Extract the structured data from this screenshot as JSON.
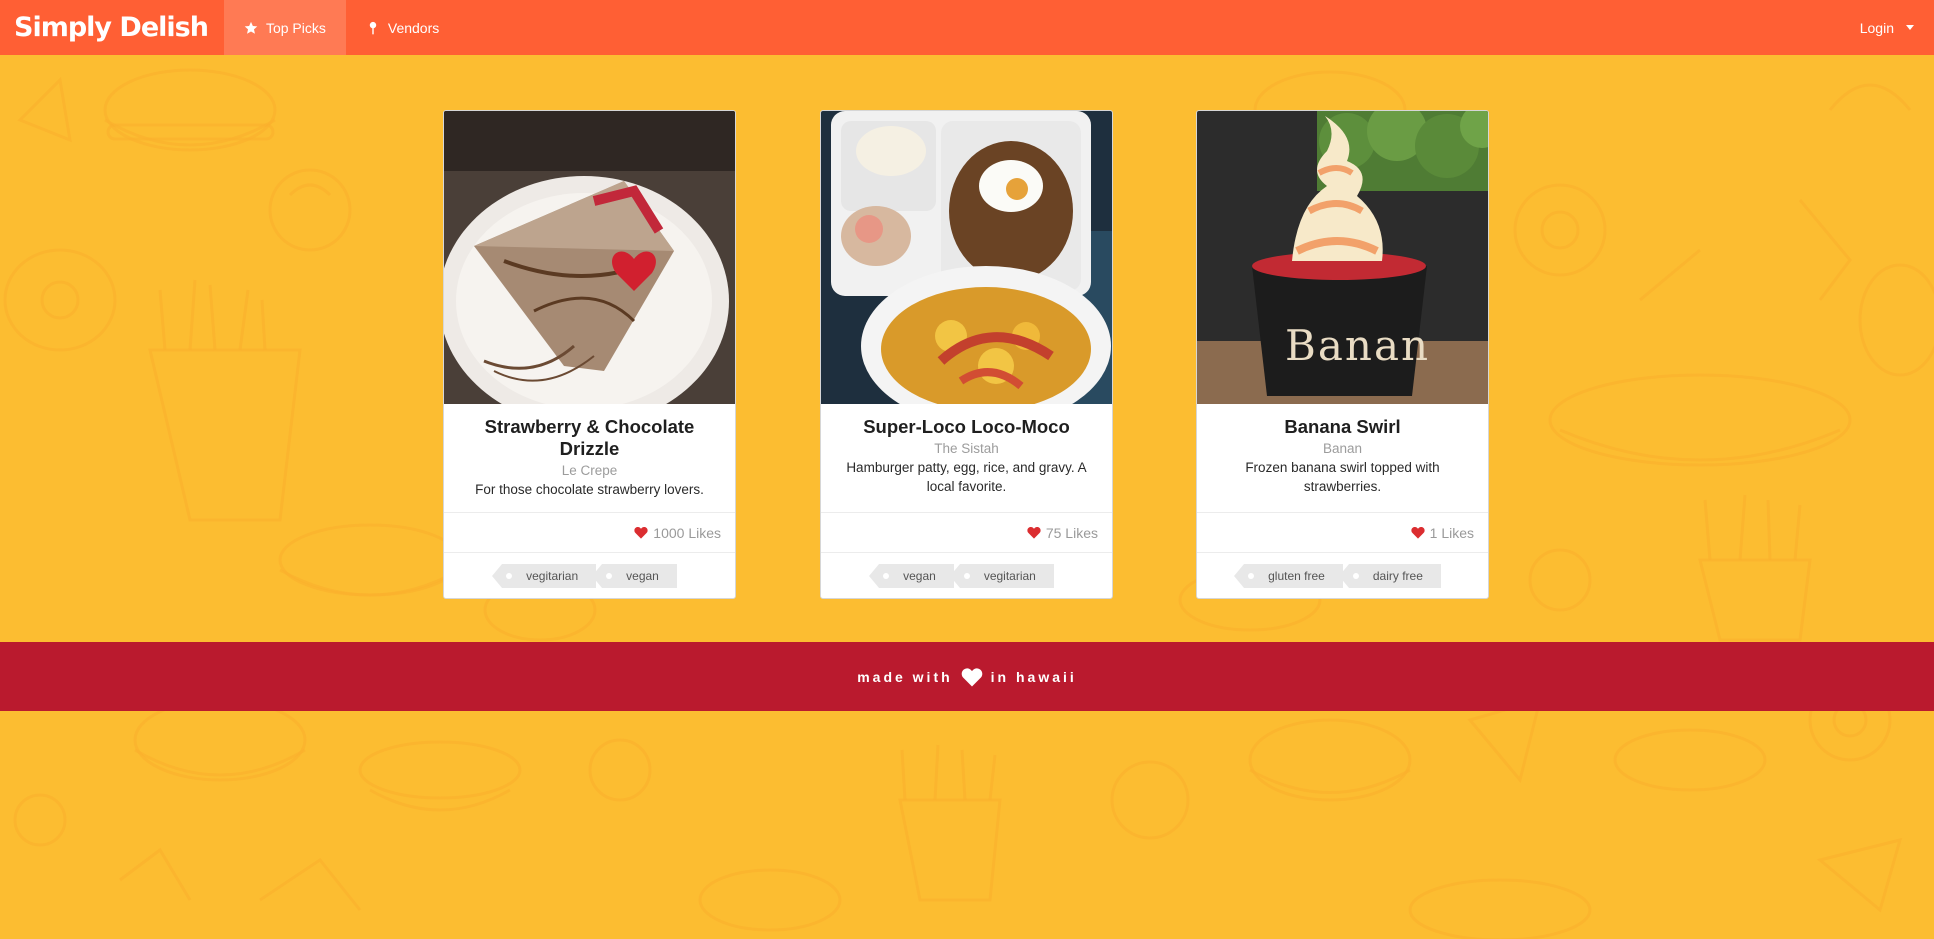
{
  "nav": {
    "brand": "Simply Delish",
    "items": [
      {
        "label": "Top Picks",
        "icon": "star-icon",
        "active": true
      },
      {
        "label": "Vendors",
        "icon": "pin-icon",
        "active": false
      }
    ],
    "login": "Login"
  },
  "cards": [
    {
      "title": "Strawberry & Chocolate Drizzle",
      "vendor": "Le Crepe",
      "description": "For those chocolate strawberry lovers.",
      "likes": "1000 Likes",
      "tags": [
        "vegitarian",
        "vegan"
      ]
    },
    {
      "title": "Super-Loco Loco-Moco",
      "vendor": "The Sistah",
      "description": "Hamburger patty, egg, rice, and gravy. A local favorite.",
      "likes": "75 Likes",
      "tags": [
        "vegan",
        "vegitarian"
      ]
    },
    {
      "title": "Banana Swirl",
      "vendor": "Banan",
      "description": "Frozen banana swirl topped with strawberries.",
      "likes": "1 Likes",
      "tags": [
        "gluten free",
        "dairy free"
      ]
    }
  ],
  "footer": {
    "before": "made with",
    "after": "in hawaii"
  },
  "photo_text": {
    "cup_logo": "Banan"
  },
  "colors": {
    "background": "#fcbd31",
    "navbar": "#ff5f34",
    "footer": "#ba1a2e",
    "heart": "#db2d30"
  }
}
